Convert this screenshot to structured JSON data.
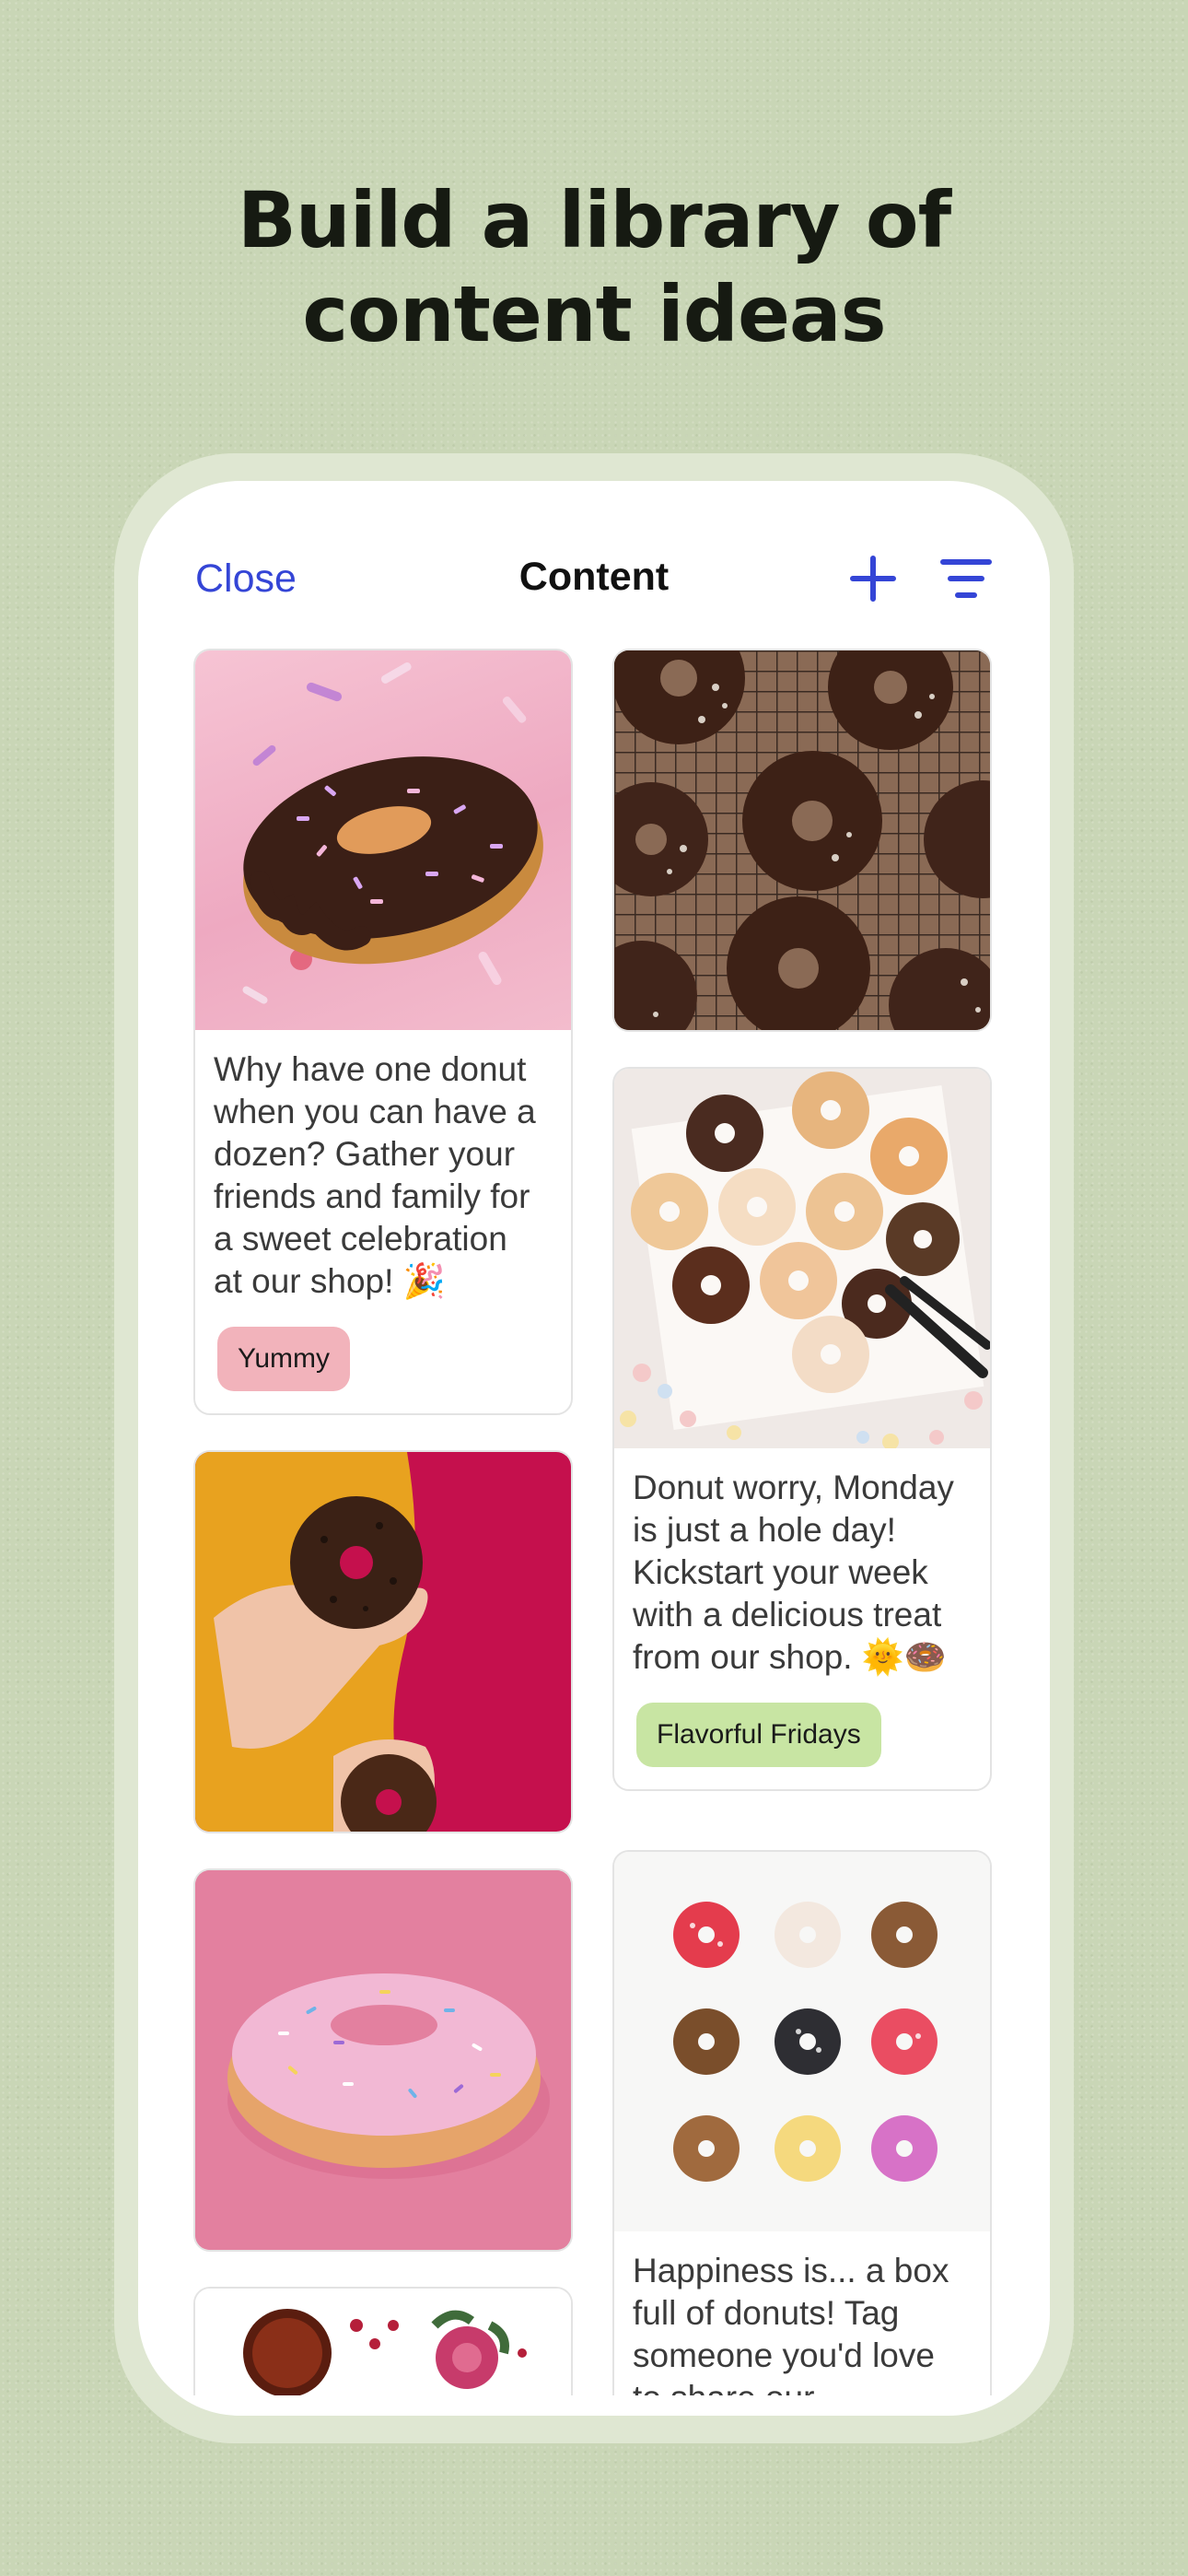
{
  "headline": {
    "line1": "Build a library of",
    "line2": "content ideas"
  },
  "nav": {
    "close": "Close",
    "title": "Content",
    "add_icon": "plus-icon",
    "filter_icon": "filter-icon"
  },
  "colors": {
    "accent": "#3445d6",
    "tag_yummy": "#f2b3bb",
    "tag_flavorful": "#c8e5a3",
    "background": "#c9d6b6"
  },
  "cards": [
    {
      "text": "Why have one donut\nwhen you can have a\ndozen? Gather your\nfriends and family for\na sweet celebration\nat our shop! 🎉",
      "tag": "Yummy"
    },
    {
      "text": "Donut worry, Monday\nis just a hole day!\nKickstart your week\nwith a delicious treat\nfrom our shop. 🌞🍩",
      "tag": "Flavorful Fridays"
    },
    {
      "text": "Happiness is... a box\nfull of donuts! Tag\nsomeone you'd love\nto share our"
    }
  ]
}
